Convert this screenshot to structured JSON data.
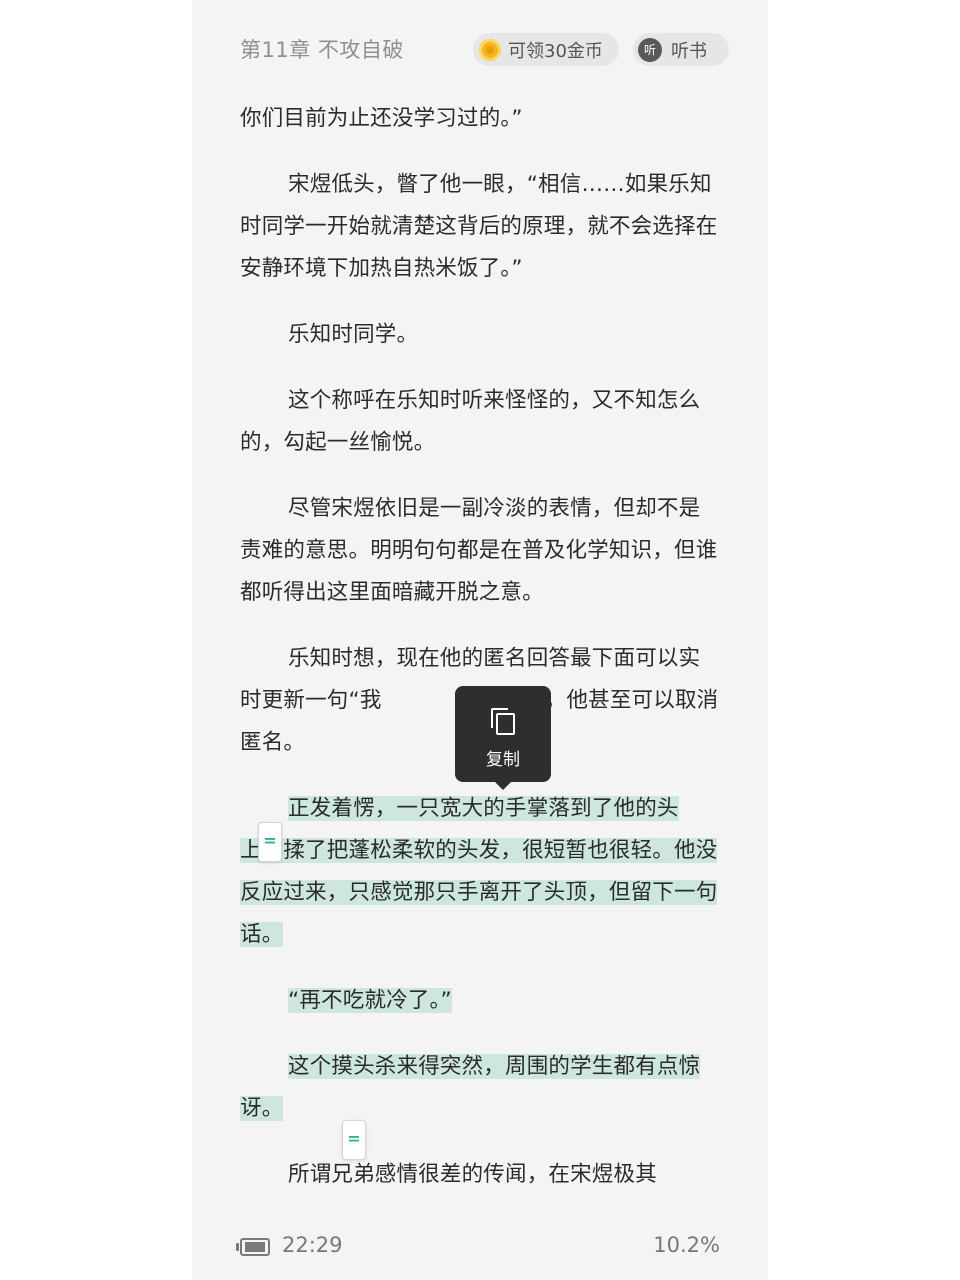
{
  "header": {
    "chapter_title": "第11章 不攻自破",
    "coin_reward_label": "可领30金币",
    "coin_icon": "coin-icon",
    "listen_icon_text": "听",
    "listen_label": "听书"
  },
  "paragraphs": [
    "你们目前为止还没学习过的。”",
    "宋煜低头，瞥了他一眼，“相信……如果乐知时同学一开始就清楚这背后的原理，就不会选择在安静环境下加热自热米饭了。”",
    "乐知时同学。",
    "这个称呼在乐知时听来怪怪的，又不知怎么的，勾起一丝愉悦。",
    "尽管宋煜依旧是一副冷淡的表情，但却不是责难的意思。明明句句都是在普及化学知识，但谁都听得出这里面暗藏开脱之意。",
    "乐知时想，现在他的匿名回答最下面可以实时更新一句“我　　　　　”，不，他甚至可以取消匿名。",
    "正发着愣，一只宽大的手掌落到了他的头上，揉了把蓬松柔软的头发，很短暂也很轻。他没反应过来，只感觉那只手离开了头顶，但留下一句话。",
    "“再不吃就冷了。”",
    "这个摸头杀来得突然，周围的学生都有点惊讶。",
    "所谓兄弟感情很差的传闻，在宋煜极其"
  ],
  "selection": {
    "copy_label": "复制",
    "copy_icon": "copy-icon",
    "handle_glyph": "=",
    "highlight_color": "#cde6e0"
  },
  "status": {
    "battery_icon": "battery-icon",
    "time": "22:29",
    "progress": "10.2%"
  }
}
